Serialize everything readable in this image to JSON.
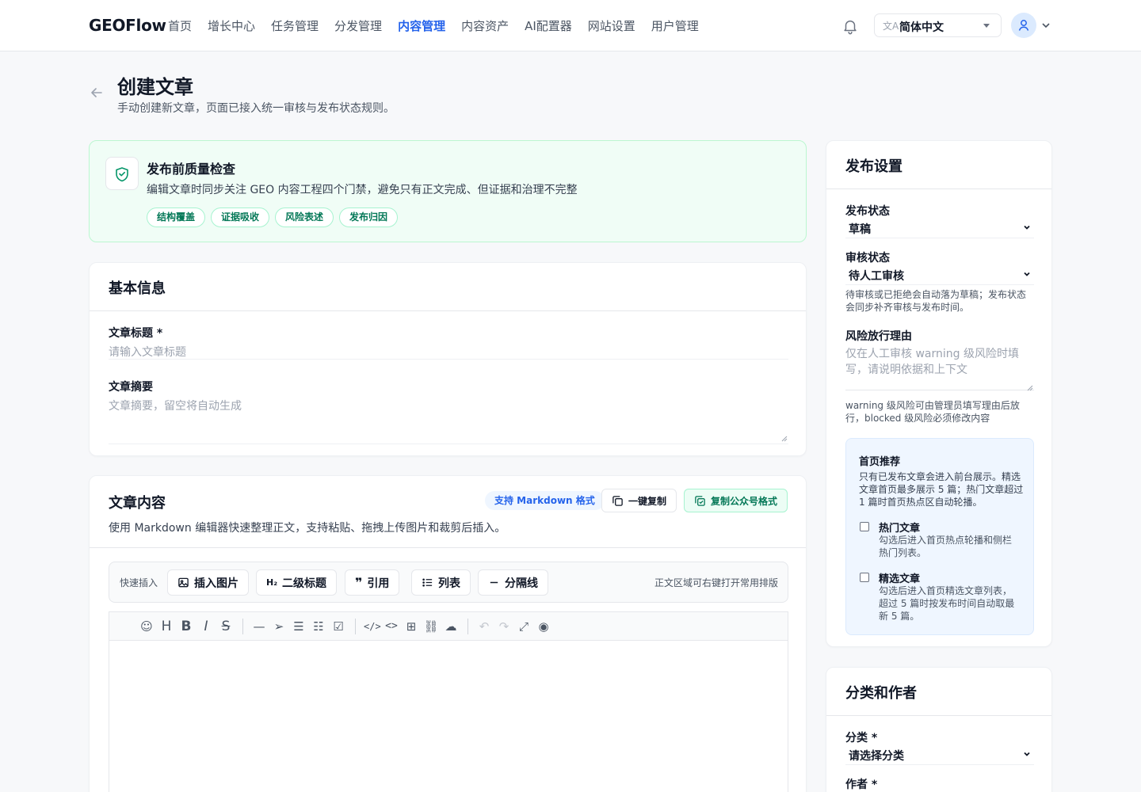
{
  "header": {
    "brand": "GEOFlow",
    "nav": [
      "首页",
      "增长中心",
      "任务管理",
      "分发管理",
      "内容管理",
      "内容资产",
      "AI配置器",
      "网站设置",
      "用户管理"
    ],
    "active_index": 4,
    "language": "简体中文"
  },
  "page": {
    "title": "创建文章",
    "subtitle": "手动创建新文章，页面已接入统一审核与发布状态规则。"
  },
  "quality": {
    "title": "发布前质量检查",
    "desc": "编辑文章时同步关注 GEO 内容工程四个门禁，避免只有正文完成、但证据和治理不完整",
    "tags": [
      "结构覆盖",
      "证据吸收",
      "风险表述",
      "发布归因"
    ]
  },
  "basic": {
    "title": "基本信息",
    "title_label": "文章标题 *",
    "title_placeholder": "请输入文章标题",
    "summary_label": "文章摘要",
    "summary_placeholder": "文章摘要，留空将自动生成"
  },
  "content": {
    "title": "文章内容",
    "desc": "使用 Markdown 编辑器快速整理正文，支持粘贴、拖拽上传图片和裁剪后插入。",
    "markdown_badge": "支持 Markdown 格式",
    "copy_label": "一键复制",
    "copy_wechat_label": "复制公众号格式",
    "quick_label": "快速插入",
    "quick_buttons": [
      "插入图片",
      "二级标题",
      "引用",
      "列表",
      "分隔线"
    ],
    "quick_hint": "正文区域可右键打开常用排版"
  },
  "publish": {
    "title": "发布设置",
    "status_label": "发布状态",
    "status_value": "草稿",
    "review_label": "审核状态",
    "review_value": "待人工审核",
    "review_help": "待审核或已拒绝会自动落为草稿；发布状态会同步补齐审核与发布时间。",
    "risk_label": "风险放行理由",
    "risk_placeholder": "仅在人工审核 warning 级风险时填写，请说明依据和上下文",
    "risk_help": "warning 级风险可由管理员填写理由后放行，blocked 级风险必须修改内容",
    "featured": {
      "title": "首页推荐",
      "desc": "只有已发布文章会进入前台展示。精选文章首页最多展示 5 篇；热门文章超过 1 篇时首页热点区自动轮播。",
      "hot_label": "热门文章",
      "hot_desc": "勾选后进入首页热点轮播和侧栏热门列表。",
      "pick_label": "精选文章",
      "pick_desc": "勾选后进入首页精选文章列表，超过 5 篇时按发布时间自动取最新 5 篇。"
    }
  },
  "category": {
    "title": "分类和作者",
    "category_label": "分类 *",
    "category_value": "请选择分类",
    "author_label": "作者 *"
  }
}
